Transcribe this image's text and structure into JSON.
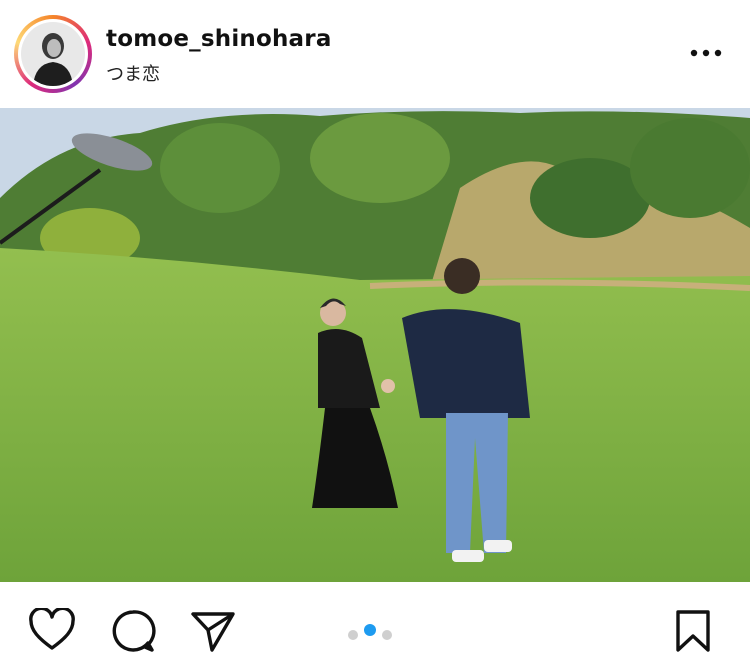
{
  "post": {
    "username": "tomoe_shinohara",
    "location": "つま恋"
  },
  "icons": {
    "more": "more-options-icon",
    "like": "heart-icon",
    "comment": "comment-icon",
    "share": "send-icon",
    "save": "bookmark-icon"
  },
  "carousel": {
    "count": 3,
    "active_index": 1
  },
  "colors": {
    "active_dot": "#1d9bf0",
    "inactive_dot": "#cfcfcf",
    "grass": "#7cb342",
    "sky": "#c9d7e6"
  }
}
